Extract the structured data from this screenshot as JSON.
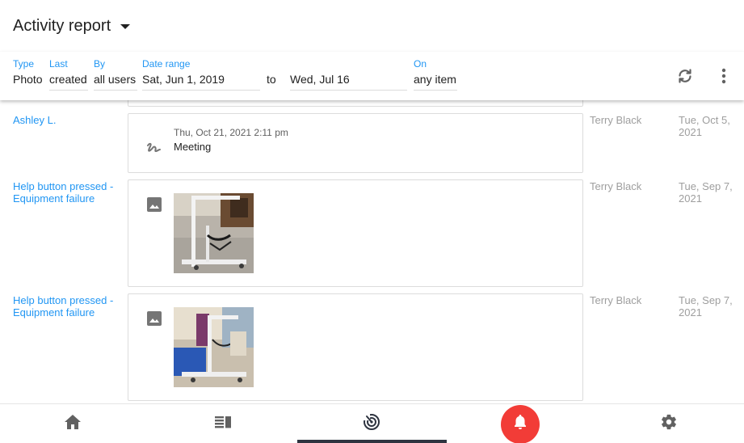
{
  "header": {
    "title": "Activity report"
  },
  "filters": {
    "type": {
      "label": "Type",
      "value": "Photo"
    },
    "last": {
      "label": "Last",
      "value": "created"
    },
    "by": {
      "label": "By",
      "value": "all users"
    },
    "date_range": {
      "label": "Date range",
      "from": "Sat, Jun 1, 2019",
      "separator": "to",
      "to": "Wed, Jul 16"
    },
    "on": {
      "label": "On",
      "value": "any item"
    }
  },
  "colors": {
    "accent": "#2196f3",
    "alert": "#f23c37",
    "muted": "#9e9e9e"
  },
  "icons": {
    "dropdown": "caret-down-icon",
    "sync": "sync-icon",
    "more": "more-vert-icon",
    "signature": "signature-icon",
    "image": "image-icon"
  },
  "rows": [
    {
      "who": "Ashley L.",
      "entry": {
        "kind": "signature",
        "timestamp": "Thu, Oct 21, 2021 2:11 pm",
        "note": "Meeting"
      },
      "user": "Terry Black",
      "date": "Tue, Oct 5, 2021"
    },
    {
      "who": "Help button pressed - Equipment failure",
      "entry": {
        "kind": "photo"
      },
      "user": "Terry Black",
      "date": "Tue, Sep 7, 2021"
    },
    {
      "who": "Help button pressed - Equipment failure",
      "entry": {
        "kind": "photo"
      },
      "user": "Terry Black",
      "date": "Tue, Sep 7, 2021"
    }
  ],
  "nav": {
    "items": [
      "home-icon",
      "feed-icon",
      "radar-icon",
      "alert-bell-icon",
      "settings-icon"
    ],
    "active": "radar-icon"
  }
}
